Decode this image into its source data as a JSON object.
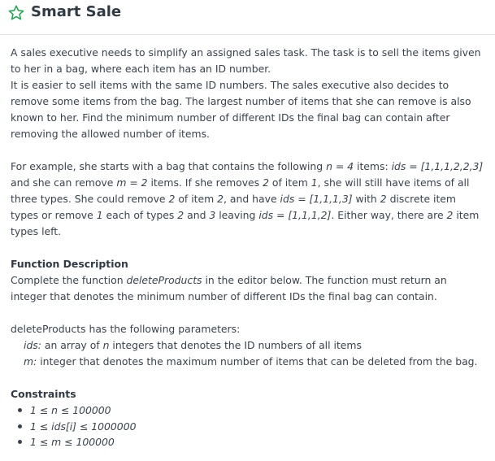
{
  "header": {
    "title": "Smart Sale",
    "icon": "star-outline-icon",
    "icon_color": "#1ba94c"
  },
  "description": {
    "line1": "A sales executive needs to simplify an assigned sales task. The task is to sell the items given to her in a bag, where each item has an ID number.",
    "line2": "It is easier to sell items with the same ID numbers. The sales executive also decides to remove some items from the bag. The largest number of items that she can remove is also known to her. Find the minimum number of different IDs the final bag can contain after removing the allowed number of items."
  },
  "example": {
    "t1": "For example, she starts with a bag that contains the following ",
    "n_eq": "n = 4",
    "t2": " items: ",
    "ids_eq": "ids = [1,1,1,2,2,3]",
    "t3": " and she can remove ",
    "m_eq": "m = 2",
    "t4": " items. If she removes ",
    "two_a": "2",
    "t5": " of item ",
    "one_a": "1",
    "t6": ", she will still have items of all three types. She could remove ",
    "two_b": "2",
    "t7": " of item ",
    "two_c": "2",
    "t8": ", and have ",
    "ids_eq2": "ids = [1,1,1,3]",
    "t9": " with ",
    "two_d": "2",
    "t10": " discrete item types or remove ",
    "one_b": "1",
    "t11": " each of types ",
    "two_e": "2",
    "t12": " and ",
    "three_a": "3",
    "t13": " leaving ",
    "ids_eq3": "ids = [1,1,1,2]",
    "t14": ".  Either way, there are ",
    "two_f": "2",
    "t15": " item types left."
  },
  "function_description": {
    "heading": "Function Description",
    "t1": "Complete the function ",
    "fn_name": "deleteProducts",
    "t2": " in the editor below. The function must return an integer that denotes the minimum number of different IDs the final bag can contain."
  },
  "parameters": {
    "intro": "deleteProducts has the following parameters:",
    "ids_name": "ids:",
    "ids_t1": " an array of ",
    "ids_n": "n",
    "ids_t2": " integers that denotes the ID numbers of all items",
    "m_name": "m:",
    "m_desc": " integer that denotes the maximum number of items that can be deleted from the bag."
  },
  "constraints": {
    "heading": "Constraints",
    "items": [
      "1 ≤ n ≤ 100000",
      "1 ≤ ids[i] ≤ 1000000",
      "1 ≤ m ≤ 100000"
    ]
  }
}
